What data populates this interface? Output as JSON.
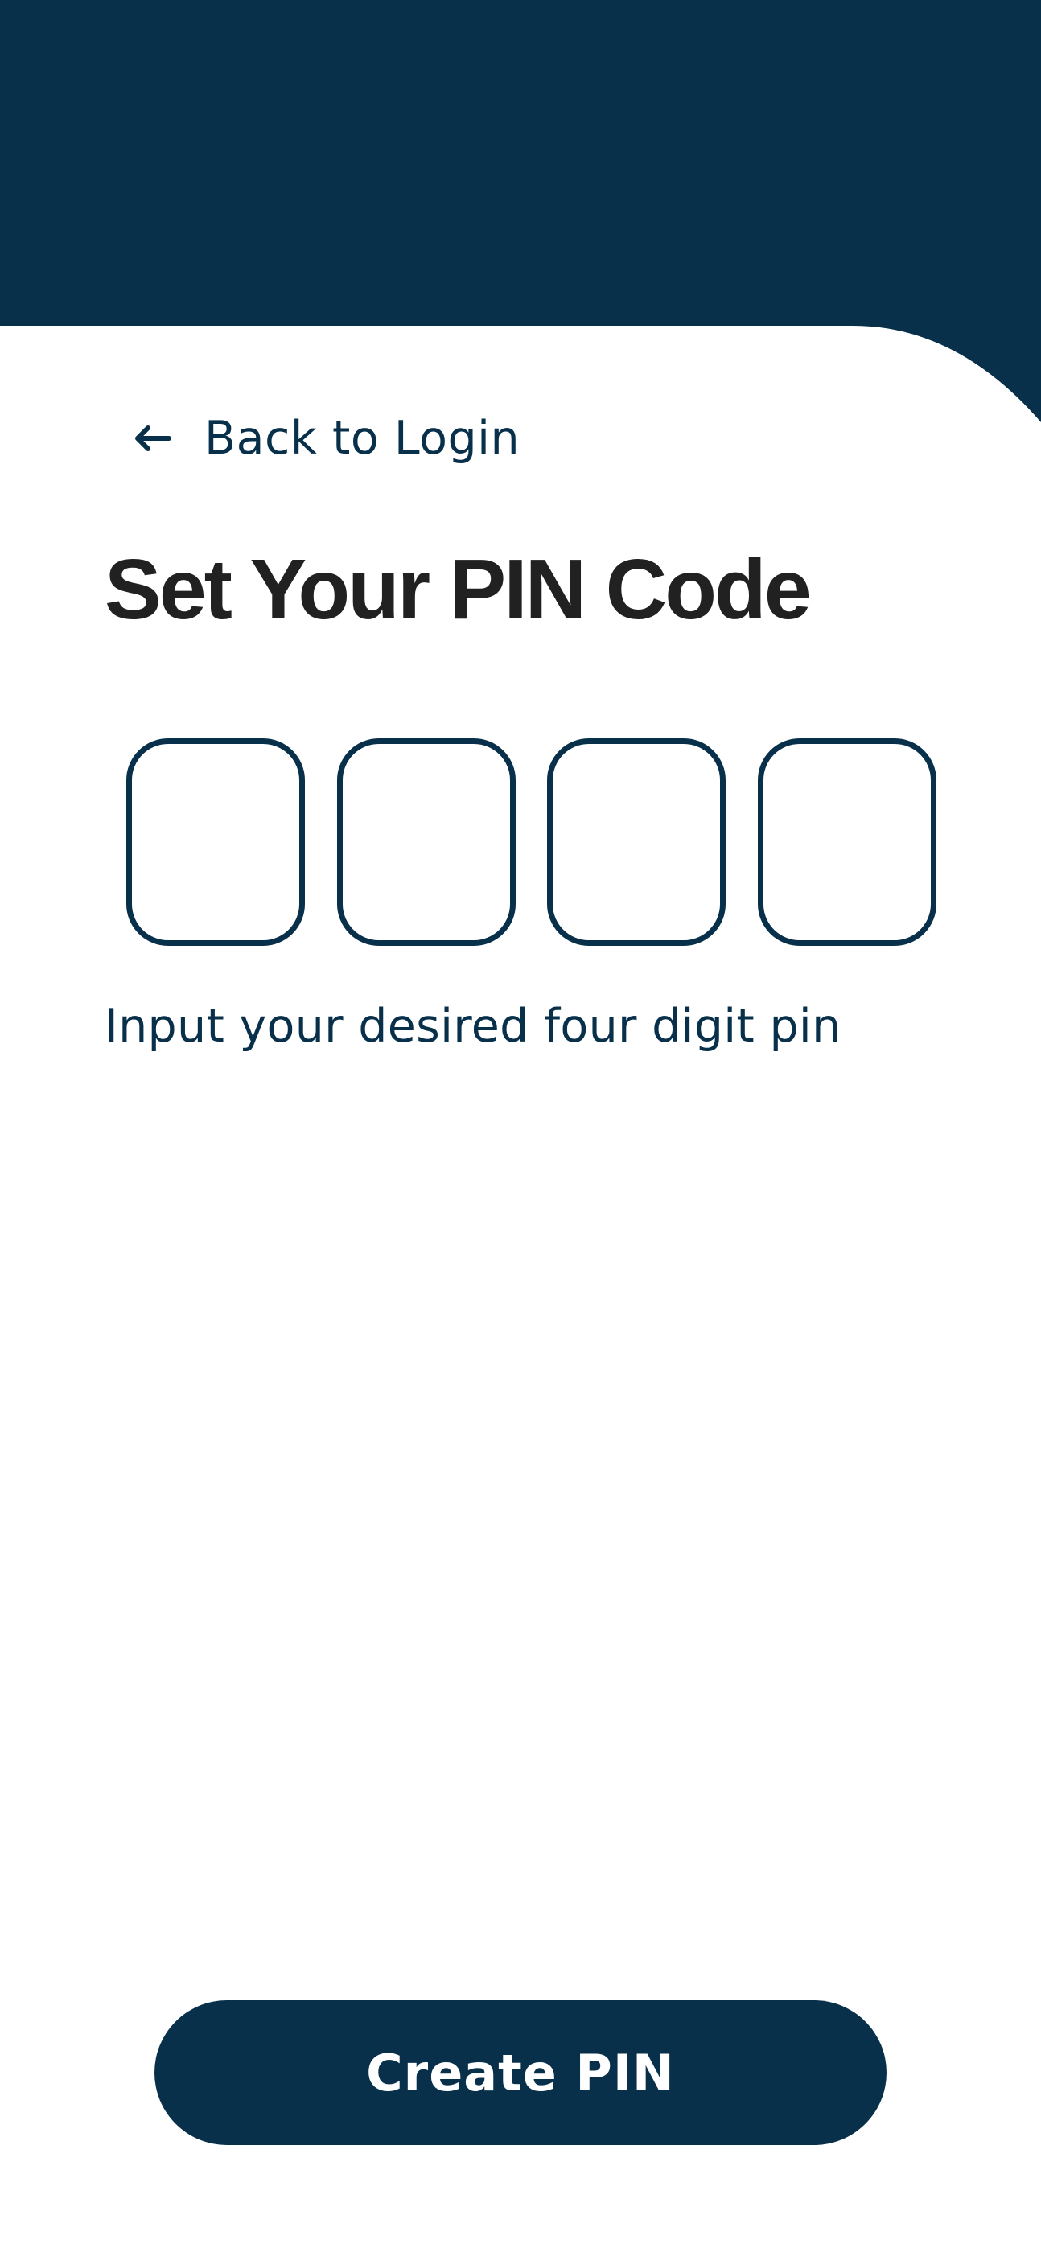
{
  "colors": {
    "brand_navy": "#08304a",
    "title_text": "#212121",
    "background": "#ffffff",
    "button_text": "#ffffff"
  },
  "nav": {
    "back_icon": "arrow-left-icon",
    "back_label": "Back to Login"
  },
  "page": {
    "title": "Set Your PIN Code",
    "hint": "Input your desired four digit pin"
  },
  "pin": {
    "digits": [
      "",
      "",
      "",
      ""
    ]
  },
  "actions": {
    "submit_label": "Create PIN"
  }
}
